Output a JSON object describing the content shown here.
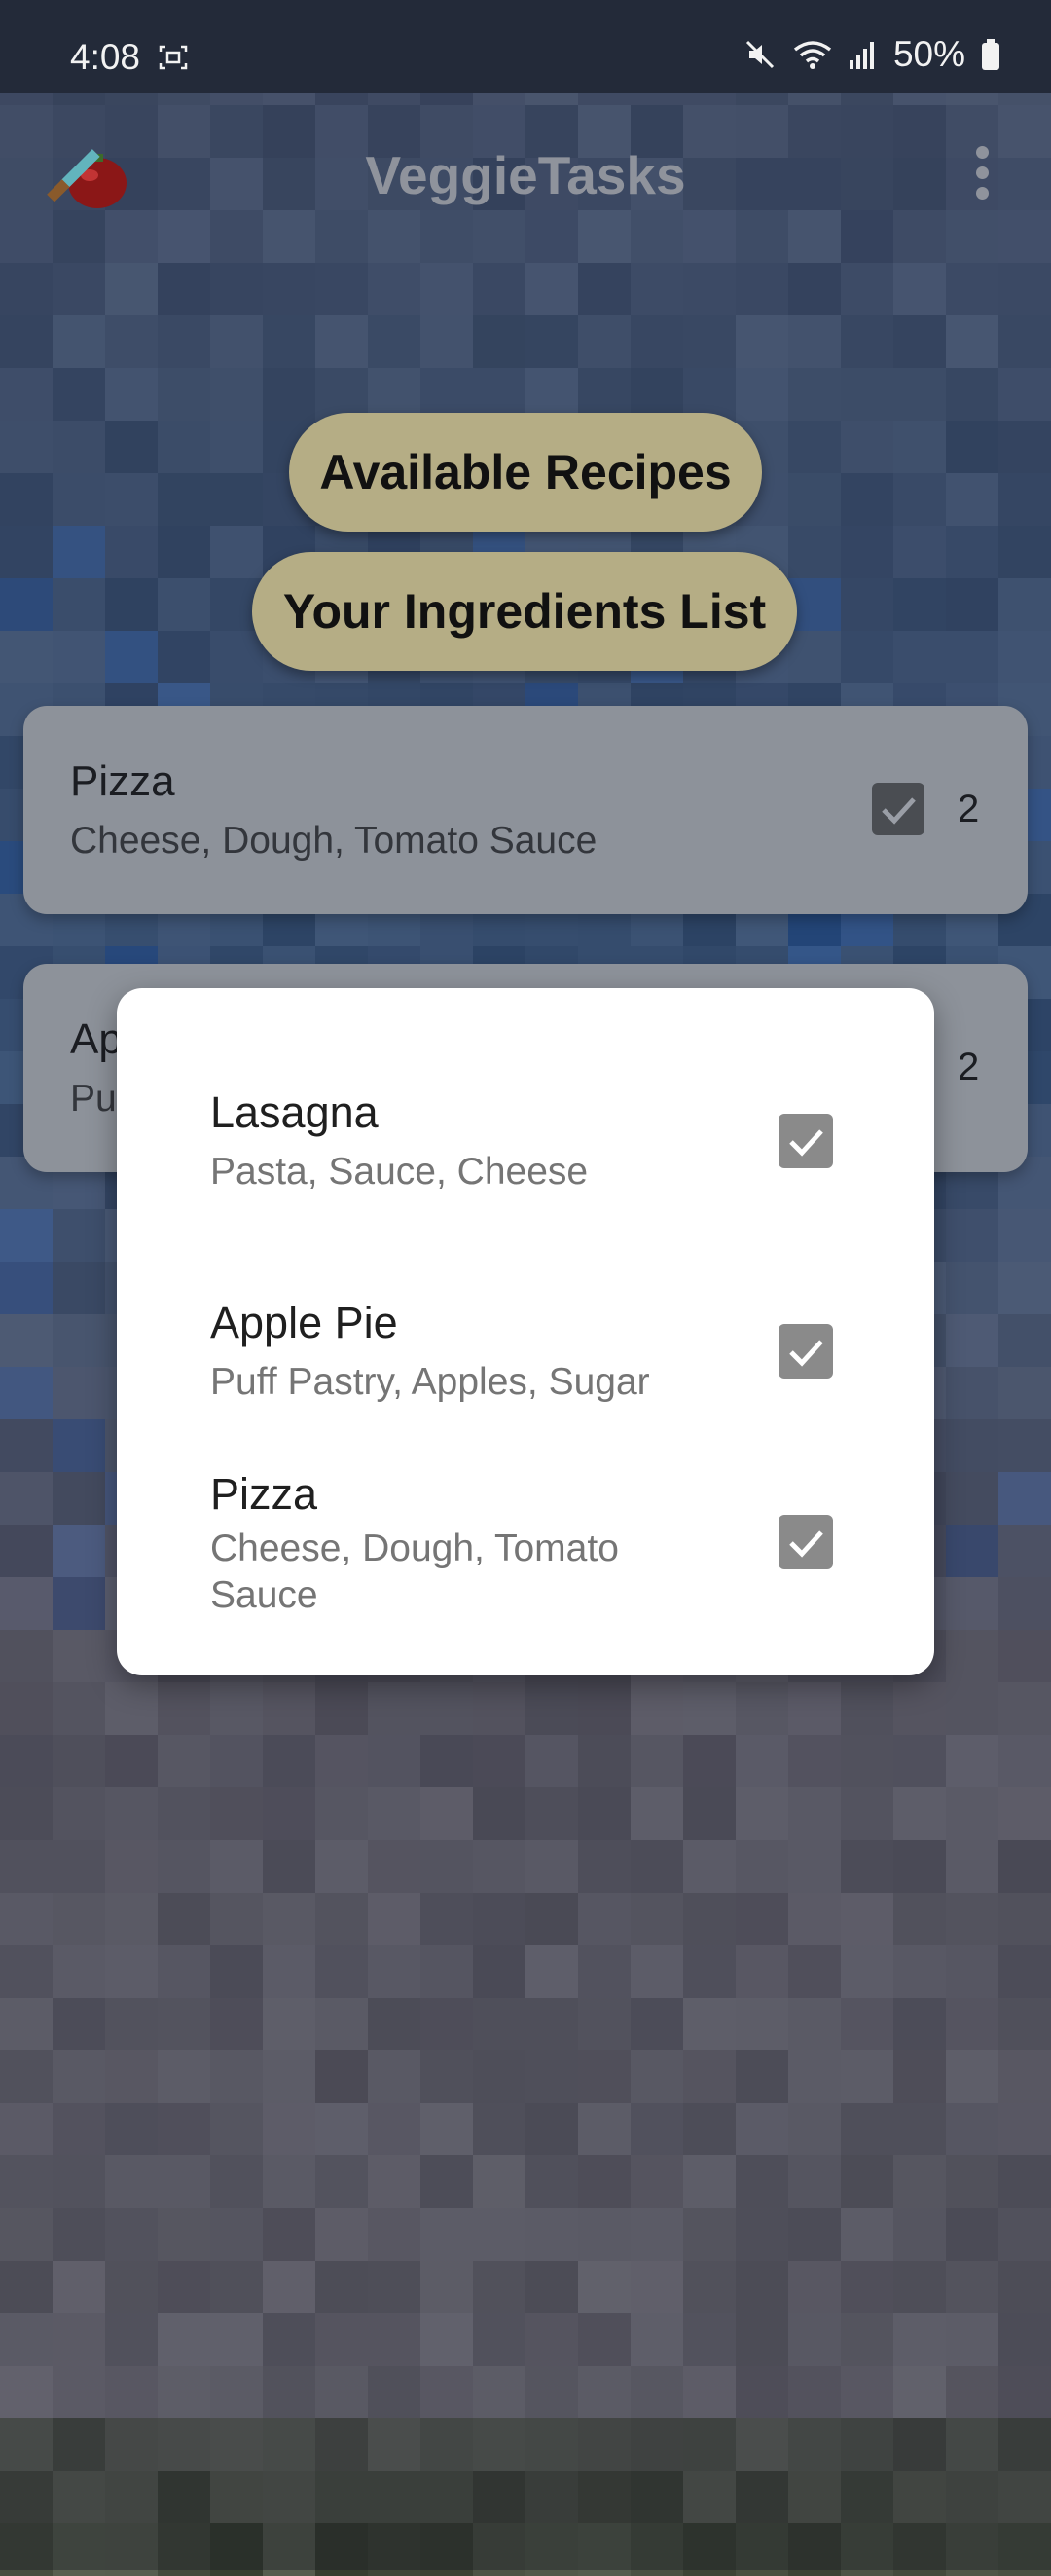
{
  "status_bar": {
    "time": "4:08",
    "battery_percent": "50%",
    "icons": [
      "screenshot-icon",
      "mute-icon",
      "wifi-icon",
      "signal-icon",
      "battery-icon"
    ]
  },
  "app_bar": {
    "title": "VeggieTasks",
    "logo_icon": "tomato-knife-logo",
    "menu_icon": "more-vert-icon"
  },
  "buttons": {
    "available_recipes": "Available Recipes",
    "ingredients_list": "Your Ingredients List"
  },
  "cards": [
    {
      "title": "Pizza",
      "subtitle": "Cheese, Dough, Tomato Sauce",
      "checked": true,
      "count": "2"
    },
    {
      "title": "Ap",
      "subtitle": "Pu",
      "checked": true,
      "count": "2"
    }
  ],
  "dialog": {
    "items": [
      {
        "title": "Lasagna",
        "subtitle": "Pasta, Sauce, Cheese",
        "checked": true
      },
      {
        "title": "Apple Pie",
        "subtitle": "Puff Pastry, Apples, Sugar",
        "checked": true
      },
      {
        "title": "Pizza",
        "subtitle": "Cheese, Dough, Tomato Sauce",
        "checked": true
      }
    ]
  },
  "colors": {
    "button_bg": "#b5ad85",
    "card_bg": "#8d929a",
    "checkbox": "#8a8a8a",
    "status_bar": "#232a39"
  }
}
